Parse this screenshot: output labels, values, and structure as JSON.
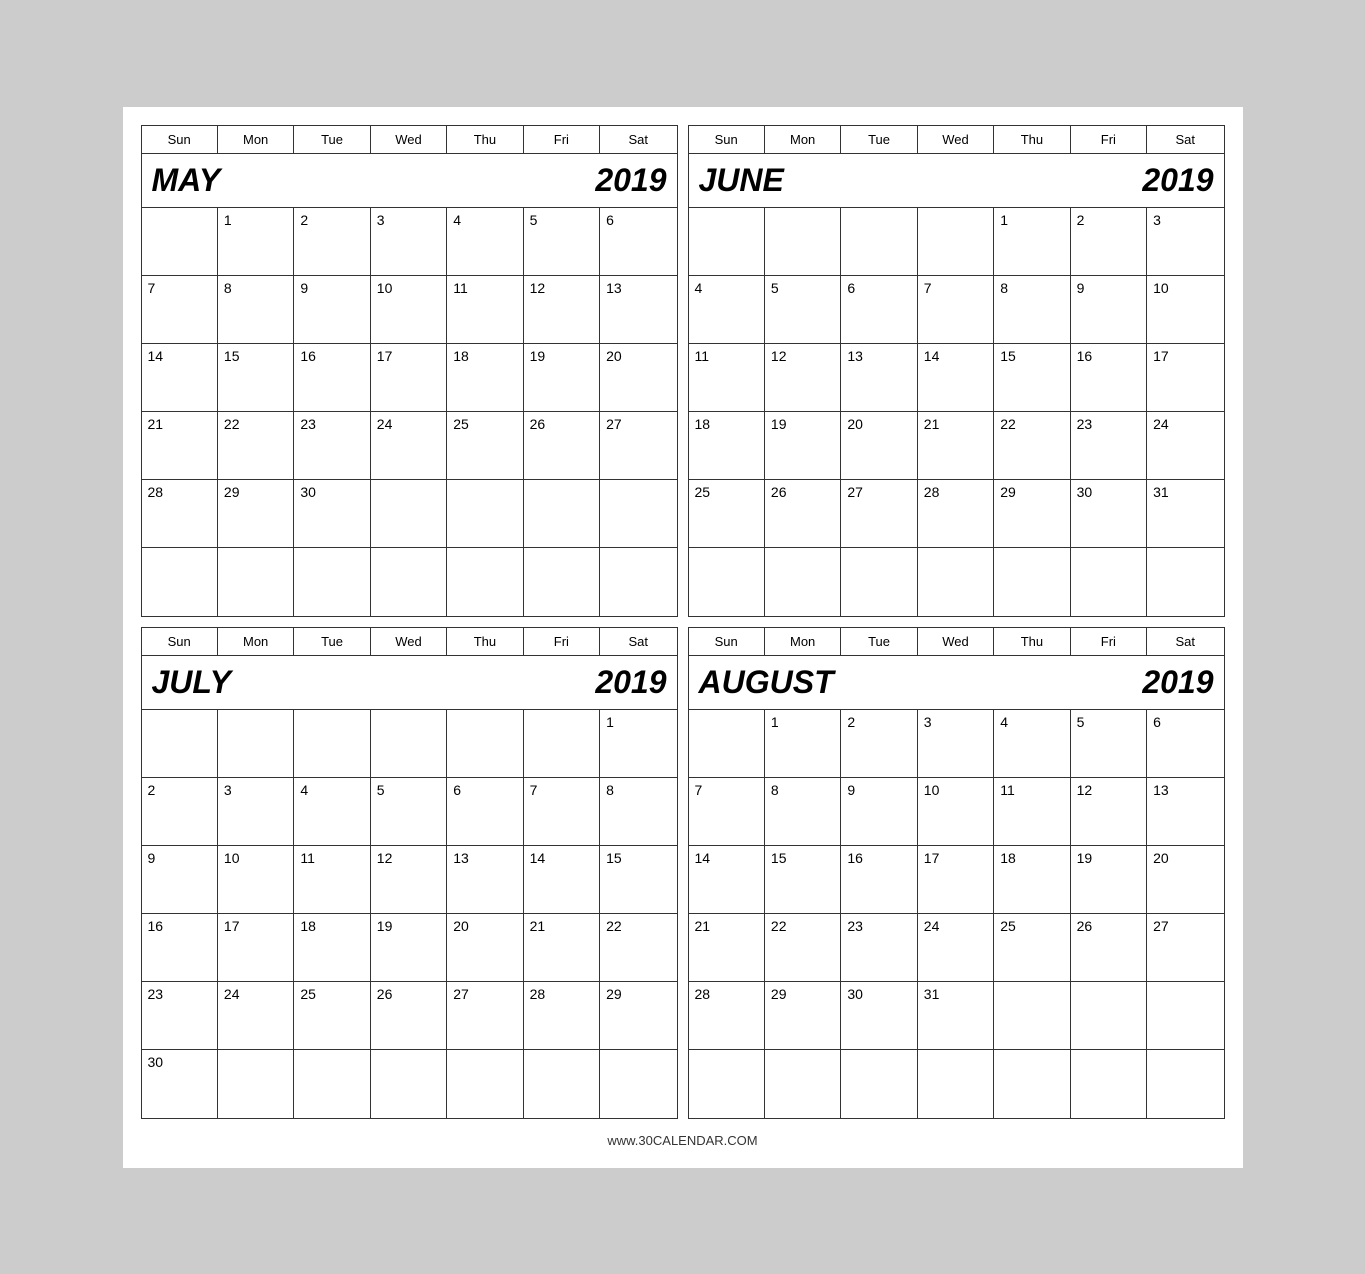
{
  "footer": "www.30CALENDAR.COM",
  "calendars": [
    {
      "id": "may",
      "month": "MAY",
      "year": "2019",
      "days": [
        "Sun",
        "Mon",
        "Tue",
        "Wed",
        "Thu",
        "Fri",
        "Sat"
      ],
      "weeks": [
        [
          "",
          "1",
          "2",
          "3",
          "4",
          "5",
          "6"
        ],
        [
          "7",
          "8",
          "9",
          "10",
          "11",
          "12",
          "13"
        ],
        [
          "14",
          "15",
          "16",
          "17",
          "18",
          "19",
          "20"
        ],
        [
          "21",
          "22",
          "23",
          "24",
          "25",
          "26",
          "27"
        ],
        [
          "28",
          "29",
          "30",
          "",
          "",
          "",
          ""
        ],
        [
          "",
          "",
          "",
          "",
          "",
          "",
          ""
        ]
      ]
    },
    {
      "id": "june",
      "month": "JUNE",
      "year": "2019",
      "days": [
        "Sun",
        "Mon",
        "Tue",
        "Wed",
        "Thu",
        "Fri",
        "Sat"
      ],
      "weeks": [
        [
          "",
          "",
          "",
          "",
          "",
          "",
          ""
        ],
        [
          "",
          "",
          "",
          "",
          "1",
          "2",
          "3",
          "4"
        ],
        [
          "5",
          "6",
          "7",
          "8",
          "9",
          "10",
          "11"
        ],
        [
          "12",
          "13",
          "14",
          "15",
          "16",
          "17",
          "18"
        ],
        [
          "19",
          "20",
          "21",
          "22",
          "23",
          "24",
          "25"
        ],
        [
          "26",
          "27",
          "28",
          "29",
          "30",
          "31",
          ""
        ]
      ]
    },
    {
      "id": "july",
      "month": "JULY",
      "year": "2019",
      "days": [
        "Sun",
        "Mon",
        "Tue",
        "Wed",
        "Thu",
        "Fri",
        "Sat"
      ],
      "weeks": [
        [
          "",
          "",
          "",
          "",
          "",
          "",
          "1"
        ],
        [
          "2",
          "3",
          "4",
          "5",
          "6",
          "7",
          "8"
        ],
        [
          "9",
          "10",
          "11",
          "12",
          "13",
          "14",
          "15"
        ],
        [
          "16",
          "17",
          "18",
          "19",
          "20",
          "21",
          "22"
        ],
        [
          "23",
          "24",
          "25",
          "26",
          "27",
          "28",
          "29"
        ],
        [
          "30",
          "",
          "",
          "",
          "",
          "",
          ""
        ]
      ]
    },
    {
      "id": "august",
      "month": "AUGUST",
      "year": "2019",
      "days": [
        "Sun",
        "Mon",
        "Tue",
        "Wed",
        "Thu",
        "Fri",
        "Sat"
      ],
      "weeks": [
        [
          "",
          "",
          "",
          "",
          "",
          "",
          ""
        ],
        [
          "",
          "1",
          "2",
          "3",
          "4",
          "5",
          "6"
        ],
        [
          "7",
          "8",
          "9",
          "10",
          "11",
          "12",
          "13"
        ],
        [
          "14",
          "15",
          "16",
          "17",
          "18",
          "19",
          "20"
        ],
        [
          "21",
          "22",
          "23",
          "24",
          "25",
          "26",
          "27"
        ],
        [
          "28",
          "29",
          "30",
          "31",
          "",
          "",
          ""
        ]
      ]
    }
  ]
}
